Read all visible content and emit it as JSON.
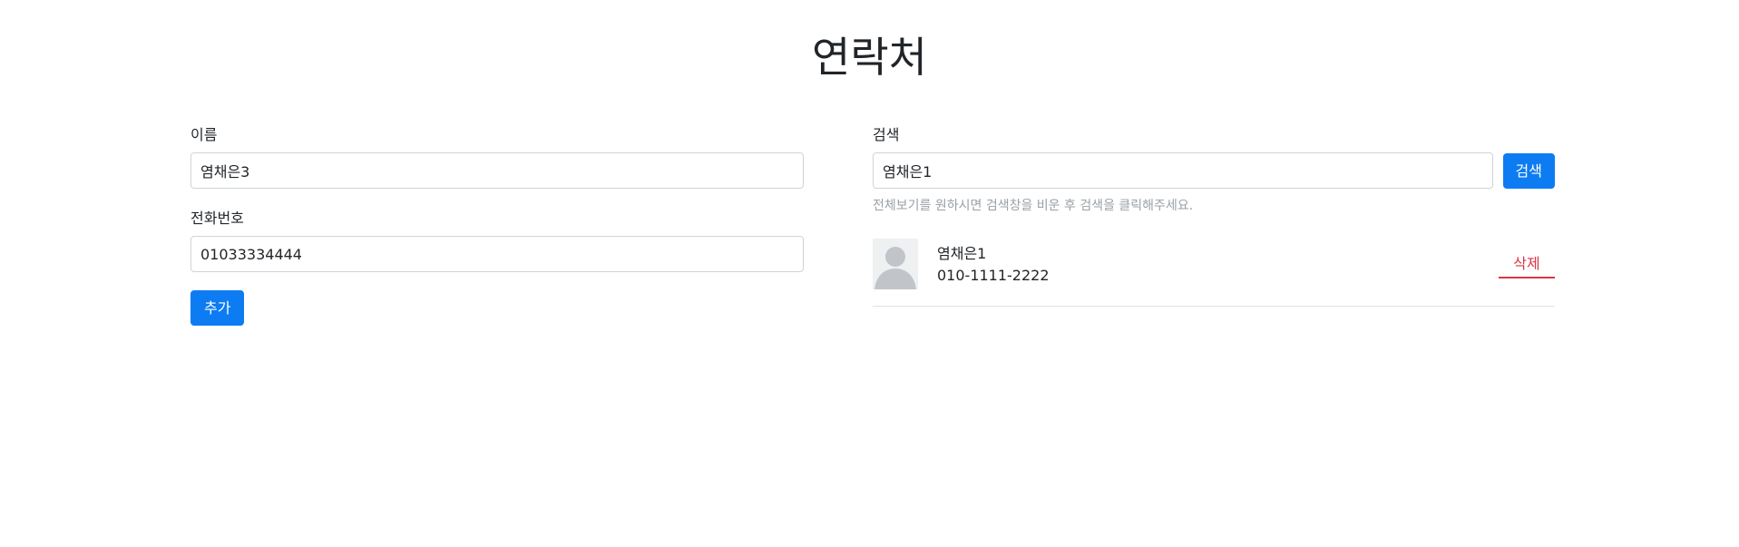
{
  "page": {
    "title": "연락처"
  },
  "form": {
    "name_label": "이름",
    "name_value": "염채은3",
    "phone_label": "전화번호",
    "phone_value": "01033334444",
    "add_label": "추가"
  },
  "search": {
    "label": "검색",
    "value": "염채은1",
    "button_label": "검색",
    "help_text": "전체보기를 원하시면 검색창을 비운 후 검색을 클릭해주세요."
  },
  "contacts": [
    {
      "name": "염채은1",
      "phone": "010-1111-2222",
      "delete_label": "삭제",
      "avatar_icon": "default-user-avatar-icon"
    }
  ],
  "colors": {
    "primary": "#0d7cf2",
    "danger": "#dc3545",
    "muted": "#9aa0a6",
    "border": "#ced4da"
  }
}
